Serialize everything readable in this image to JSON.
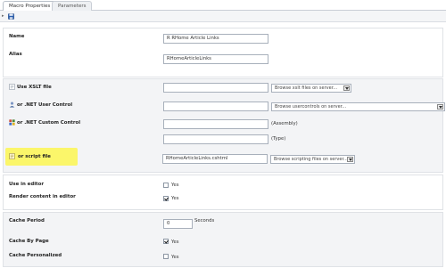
{
  "tabs": [
    {
      "label": "Macro Properties"
    },
    {
      "label": "Parameters"
    }
  ],
  "toolbar": {
    "save_icon": "save-icon",
    "colors": {
      "accent": "#2a5fb0"
    }
  },
  "properties": {
    "name_label": "Name",
    "name_value": "R RHome Article Links",
    "alias_label": "Alias",
    "alias_value": "RHomeArticleLinks"
  },
  "render": {
    "xslt_label": "Use XSLT file",
    "xslt_value": "",
    "xslt_select": "Browse xslt files on server...",
    "usercontrol_label": "or .NET User Control",
    "usercontrol_value": "",
    "usercontrol_select": "Browse usercontrols on server...",
    "customcontrol_label": "or .NET Custom Control",
    "assembly_value": "",
    "assembly_note": "(Assembly)",
    "type_value": "",
    "type_note": "(Type)",
    "script_label": "or script file",
    "script_value": "RHomeArticleLinks.cshtml",
    "script_select": "Browse scripting files on server..."
  },
  "editor": {
    "use_label": "Use in editor",
    "use_checked": false,
    "use_yes": "Yes",
    "render_label": "Render content in editor",
    "render_checked": true,
    "render_yes": "Yes"
  },
  "cache": {
    "period_label": "Cache Period",
    "period_value": "0",
    "period_unit": "Seconds",
    "bypage_label": "Cache By Page",
    "bypage_checked": true,
    "bypage_yes": "Yes",
    "personalized_label": "Cache Personalized",
    "personalized_checked": false,
    "personalized_yes": "Yes"
  }
}
